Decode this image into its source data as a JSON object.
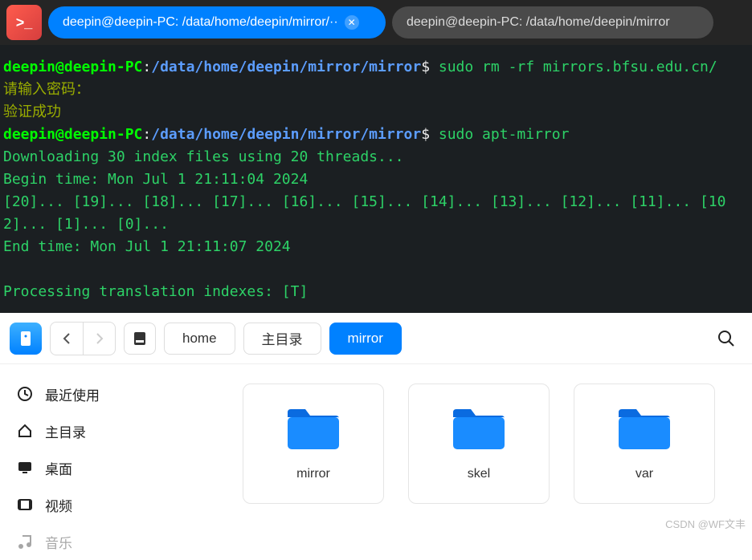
{
  "tabs": {
    "active": "deepin@deepin-PC: /data/home/deepin/mirror/··",
    "inactive": "deepin@deepin-PC: /data/home/deepin/mirror"
  },
  "terminal": {
    "line1_userhost": "deepin@deepin-PC",
    "line1_path": "/data/home/deepin/mirror/mirror",
    "line1_cmd": "sudo rm -rf mirrors.bfsu.edu.cn/",
    "line2": "请输入密码：",
    "line3": "验证成功",
    "line4_userhost": "deepin@deepin-PC",
    "line4_path": "/data/home/deepin/mirror/mirror",
    "line4_cmd": "sudo apt-mirror",
    "line5": "Downloading 30 index files using 20 threads...",
    "line6": "Begin time: Mon Jul  1 21:11:04 2024",
    "line7": "[20]... [19]... [18]... [17]... [16]... [15]... [14]... [13]... [12]... [11]... [10",
    "line8": "2]... [1]... [0]...",
    "line9": "End time: Mon Jul  1 21:11:07 2024",
    "line10": "Processing translation indexes: [T]"
  },
  "breadcrumbs": {
    "b1": "home",
    "b2": "主目录",
    "b3": "mirror"
  },
  "sidebar": {
    "s1": "最近使用",
    "s2": "主目录",
    "s3": "桌面",
    "s4": "视频",
    "s5": "音乐"
  },
  "folders": {
    "f1": "mirror",
    "f2": "skel",
    "f3": "var"
  },
  "watermark": "CSDN @WF文丰",
  "app_icon_text": ">_"
}
